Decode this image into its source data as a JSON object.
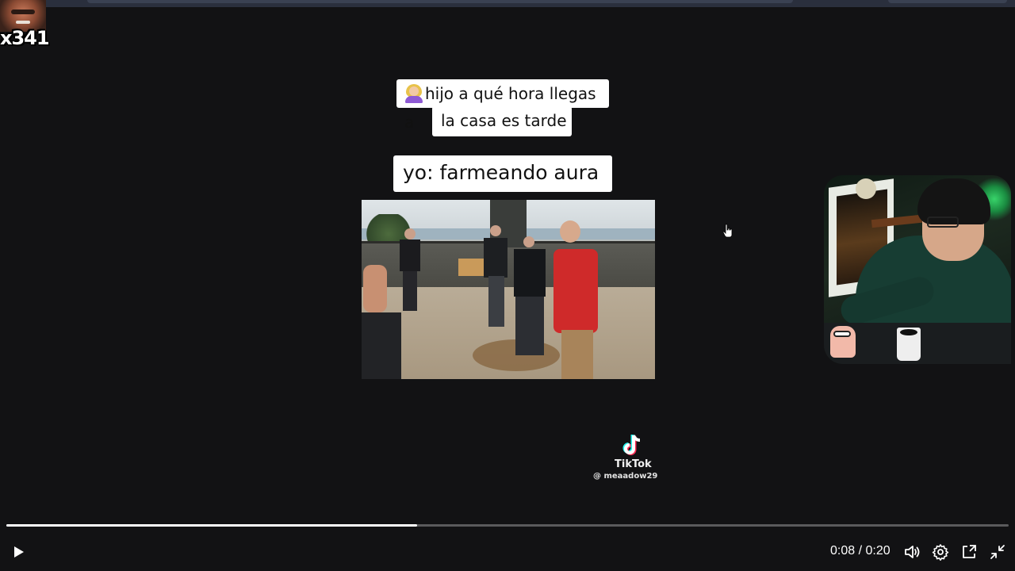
{
  "overlay": {
    "count_text": "x341"
  },
  "captions": {
    "line1a": "hijo a qué hora llegas a",
    "line1b": "la casa es tarde",
    "line2": "yo: farmeando aura",
    "emoji": "woman-emoji"
  },
  "watermark": {
    "brand": "TikTok",
    "username": "@ meaadow29",
    "icon": "tiktok-logo-icon"
  },
  "player": {
    "current_time": "0:08",
    "duration": "0:20",
    "time_text": "0:08 / 0:20",
    "progress_fraction": 0.41,
    "state": "paused",
    "controls": {
      "play": "play-icon",
      "volume": "volume-icon",
      "settings": "gear-icon",
      "pip": "picture-in-picture-icon",
      "fullscreen_exit": "exit-fullscreen-icon"
    }
  },
  "colors": {
    "background": "#121214",
    "progress_fill": "#ffffff",
    "progress_track": "#5a5a5c",
    "caption_bg": "#ffffff"
  }
}
